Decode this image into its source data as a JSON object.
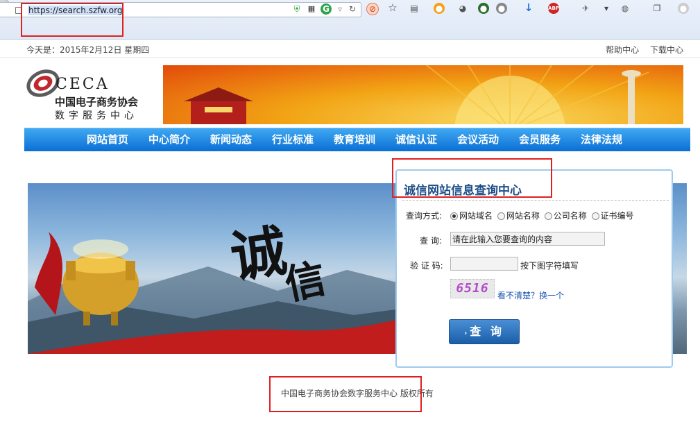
{
  "browser": {
    "url": "https://search.szfw.org",
    "toolbar_icons": [
      "shield-icon",
      "qr-icon",
      "g-icon",
      "dropdown-icon",
      "refresh-icon",
      "block-icon",
      "star-icon",
      "clipboard-icon",
      "fire-icon",
      "palette-icon",
      "leaf-icon",
      "circle-icon",
      "download-icon",
      "adblock-icon",
      "fly-icon",
      "menu-icon",
      "planet-icon",
      "window-icon",
      "orb-icon"
    ],
    "abp_label": "ABP"
  },
  "topbar": {
    "date": "今天是：2015年2月12日 星期四",
    "links": [
      "帮助中心",
      "下载中心"
    ]
  },
  "logo": {
    "brand": "CECA",
    "name": "中国电子商务协会",
    "sub": "数字服务中心",
    "colors": {
      "red": "#c0282d",
      "gray": "#5b5b5b"
    }
  },
  "nav": {
    "items": [
      "网站首页",
      "中心简介",
      "新闻动态",
      "行业标准",
      "教育培训",
      "诚信认证",
      "会议活动",
      "会员服务",
      "法律法规"
    ]
  },
  "hero": {
    "calligraphy_1": "诚",
    "calligraphy_2": "信"
  },
  "panel": {
    "title": "诚信网站信息查询中心",
    "method_label": "查询方式:",
    "options": [
      "网站域名",
      "网站名称",
      "公司名称",
      "证书编号"
    ],
    "selected_option": "网站域名",
    "query_label": "查 询:",
    "query_value": "请在此输入您要查询的内容",
    "captcha_label": "验 证 码:",
    "captcha_hint": "按下图字符填写",
    "captcha_text": "6516",
    "refresh_link": "看不清楚？换一个",
    "submit_label": "查 询"
  },
  "footer": {
    "text": "中国电子商务协会数字服务中心 版权所有"
  },
  "colors": {
    "annotation": "#e02020",
    "nav_blue": "#0a6fd4",
    "title_blue": "#1d4f8a"
  }
}
